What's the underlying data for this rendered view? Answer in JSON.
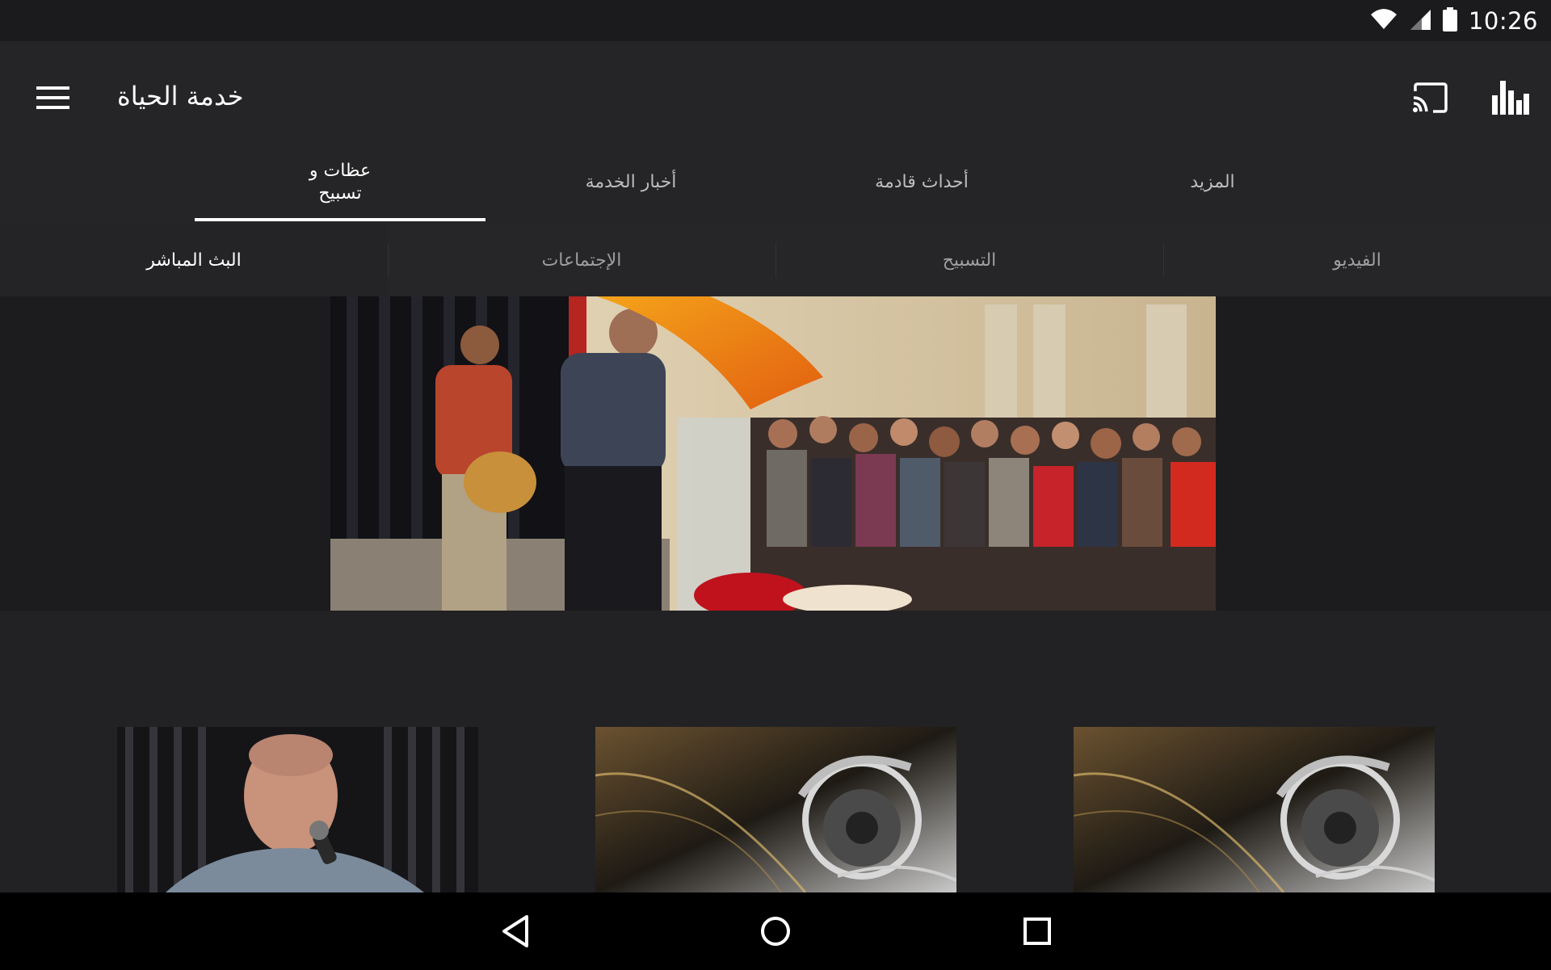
{
  "status_bar": {
    "time": "10:26",
    "icons": [
      "wifi-icon",
      "signal-icon",
      "battery-icon"
    ]
  },
  "app_bar": {
    "title": "خدمة الحياة",
    "menu_icon": "menu-icon",
    "cast_icon": "cast-icon",
    "stats_icon": "bar-chart-icon"
  },
  "tabs": [
    {
      "label": "عظات و تسبيح",
      "active": true
    },
    {
      "label": "أخبار الخدمة",
      "active": false
    },
    {
      "label": "أحداث قادمة",
      "active": false
    },
    {
      "label": "المزيد",
      "active": false
    }
  ],
  "subtabs": [
    {
      "label": "البث المباشر",
      "active": true
    },
    {
      "label": "الإجتماعات",
      "active": false
    },
    {
      "label": "التسبيح",
      "active": false
    },
    {
      "label": "الفيديو",
      "active": false
    }
  ],
  "hero": {
    "image": "worship-service-photo"
  },
  "thumbnails": [
    {
      "image": "preacher-with-microphone-photo"
    },
    {
      "image": "headphones-artwork"
    },
    {
      "image": "headphones-artwork"
    }
  ],
  "nav_bar": {
    "icons": [
      "back-icon",
      "home-icon",
      "recents-icon"
    ]
  },
  "colors": {
    "background": "#222224",
    "app_bar": "#252527",
    "status_bar": "#1b1b1d",
    "nav_bar": "#000000",
    "indicator": "#ffffff"
  }
}
